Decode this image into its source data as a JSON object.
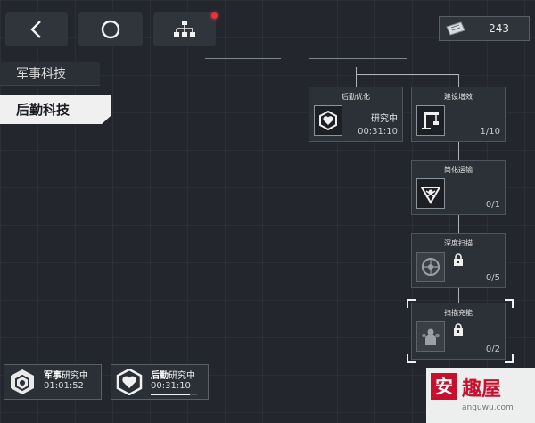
{
  "header": {
    "currency_value": "243"
  },
  "tabs": [
    {
      "label": "军事科技"
    },
    {
      "label": "后勤科技"
    }
  ],
  "tree": {
    "nodes": [
      {
        "title": "后勤优化",
        "status": "研究中",
        "time": "00:31:10",
        "icon": "shield-heart-icon",
        "locked": false
      },
      {
        "title": "建设增效",
        "progress": "1/10",
        "icon": "crane-icon",
        "locked": false
      },
      {
        "title": "简化运输",
        "progress": "0/1",
        "icon": "triangle-emblem-icon",
        "locked": false
      },
      {
        "title": "深度扫描",
        "progress": "0/5",
        "icon": "scan-wheel-icon",
        "locked": true
      },
      {
        "title": "扫描充能",
        "progress": "0/2",
        "icon": "people-group-icon",
        "locked": true
      }
    ]
  },
  "slots": [
    {
      "category": "军事",
      "status": "研究中",
      "time": "01:01:52",
      "progress": 0
    },
    {
      "category": "后勤",
      "status": "研究中",
      "time": "00:31:10",
      "progress": 0.85
    }
  ],
  "watermark": {
    "mark": "安",
    "name": "趣屋",
    "url": "anquwu.com"
  }
}
